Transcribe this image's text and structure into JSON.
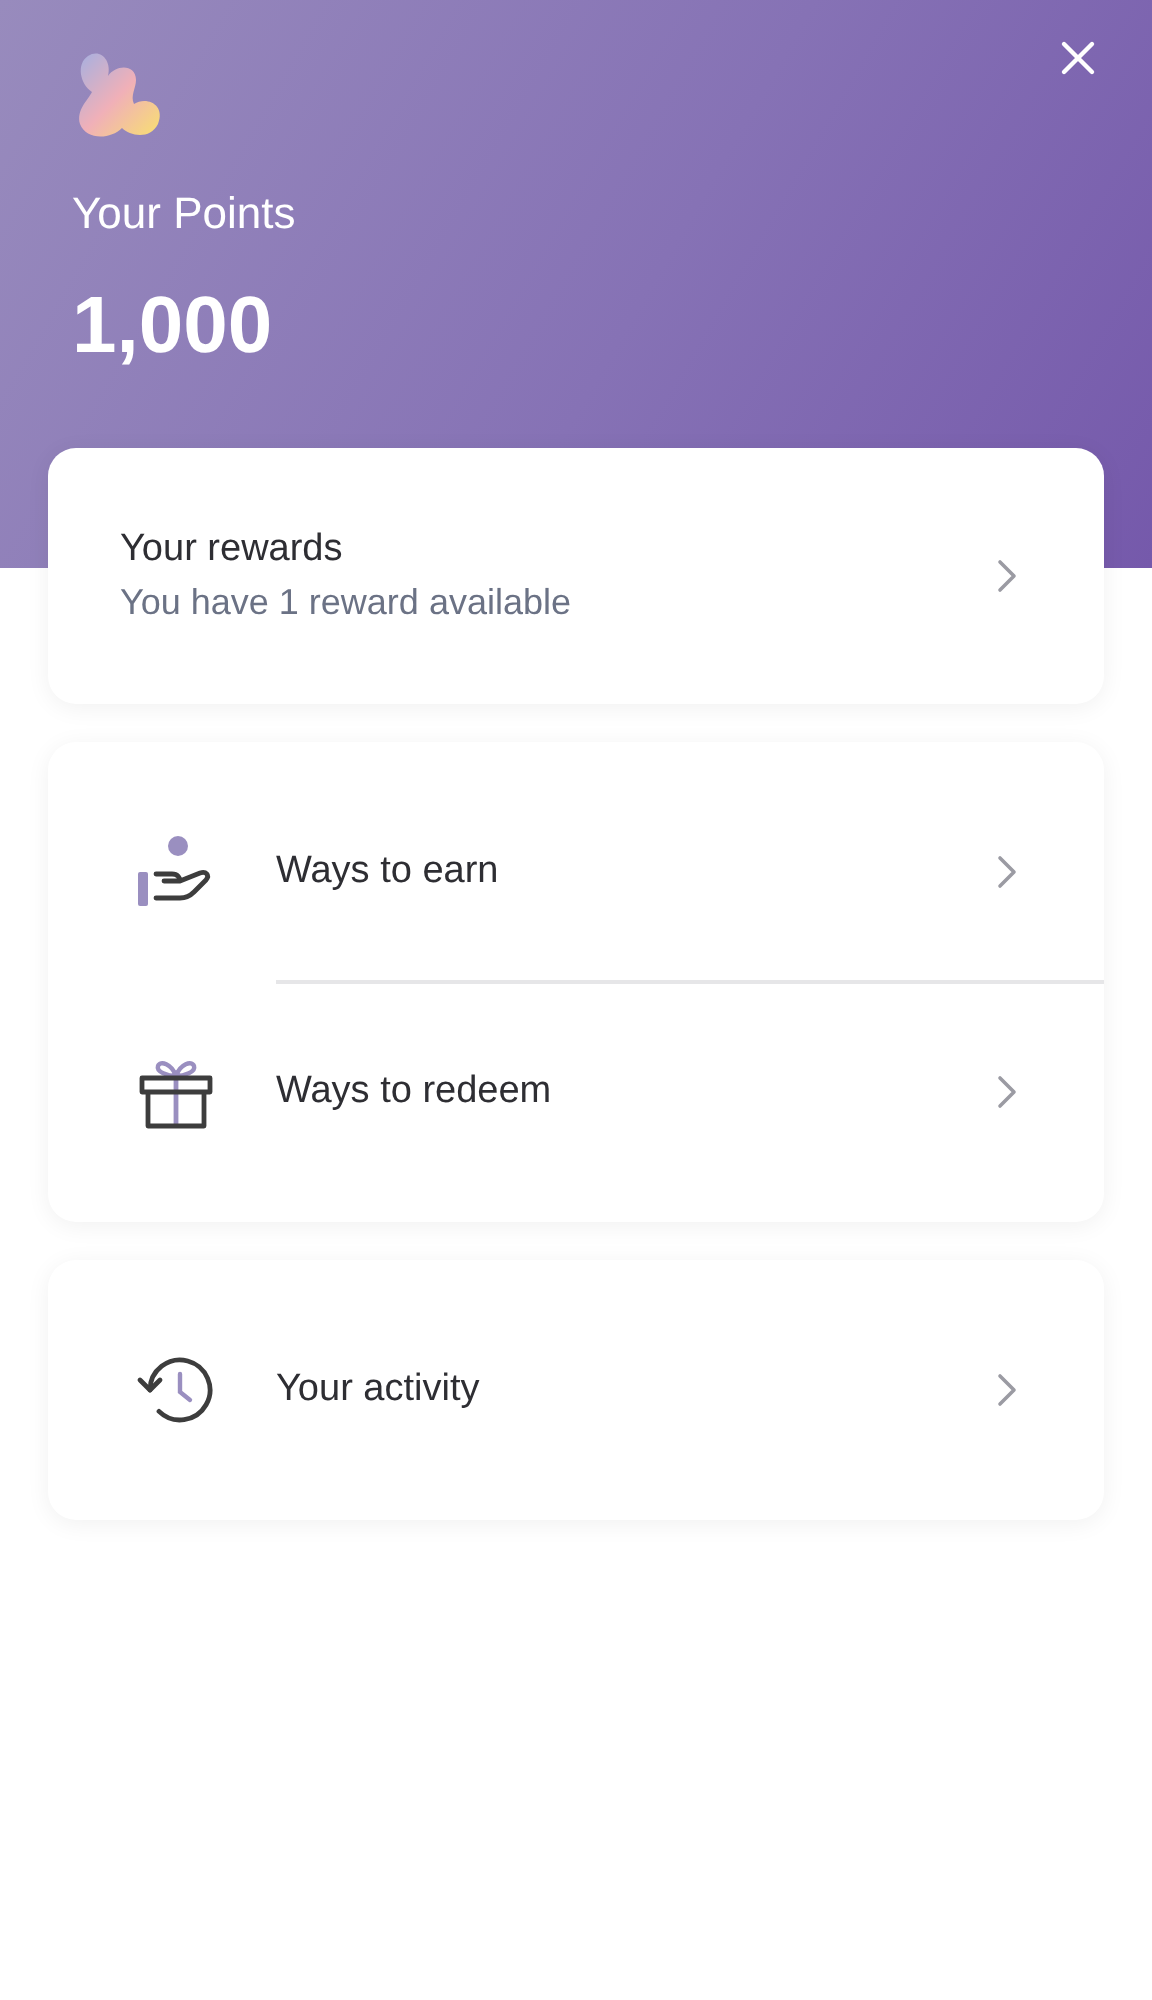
{
  "header": {
    "title": "Your Points",
    "points": "1,000"
  },
  "rewards": {
    "title": "Your rewards",
    "subtitle": "You have 1 reward available"
  },
  "menu_groups": [
    {
      "items": [
        {
          "kind": "earn",
          "label": "Ways to earn"
        },
        {
          "kind": "redeem",
          "label": "Ways to redeem"
        }
      ]
    },
    {
      "items": [
        {
          "kind": "activity",
          "label": "Your activity"
        }
      ]
    }
  ]
}
